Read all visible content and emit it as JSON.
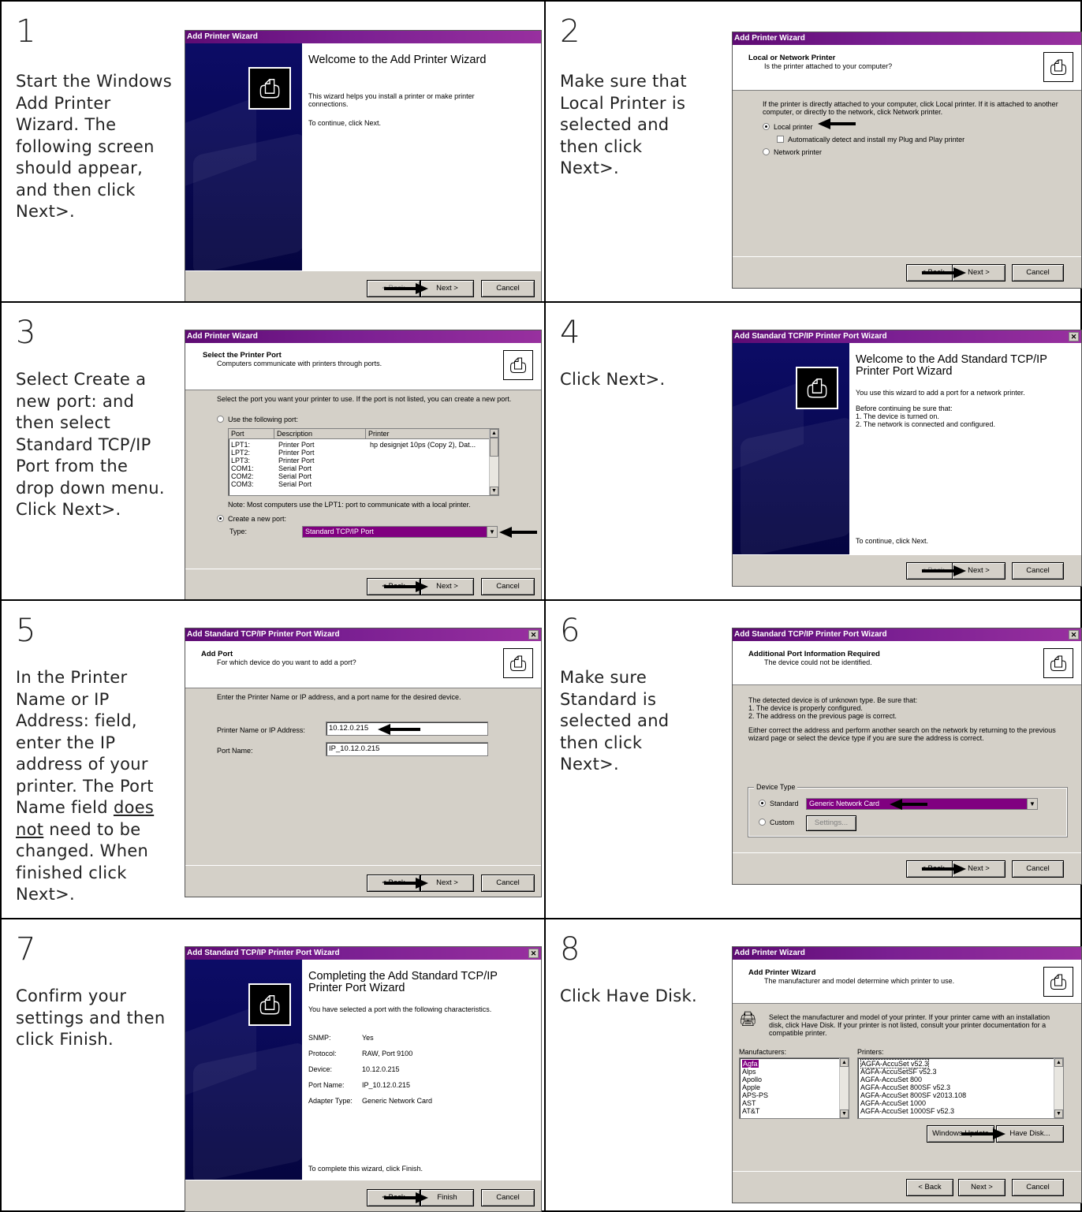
{
  "colors": {
    "title_bar": "#7a1f92",
    "dialog_bg": "#d4d0c8",
    "selection": "#800080",
    "welcome_panel": "#0c0c66"
  },
  "steps": [
    {
      "num": "1",
      "text": "Start the Windows Add Printer Wizard. The following screen should appear, and then click Next>."
    },
    {
      "num": "2",
      "text": "Make sure that Local Printer is selected and then click Next>."
    },
    {
      "num": "3",
      "text": "Select Create a new port: and then select Standard TCP/IP Port from the drop down menu. Click Next>."
    },
    {
      "num": "4",
      "text": "Click Next>."
    },
    {
      "num": "5",
      "text_a": "In the Printer Name or IP Address: field, enter the IP address of your printer. The Port Name field",
      "text_u": "does not",
      "text_b": "need to be changed. When finished click Next>."
    },
    {
      "num": "6",
      "text": "Make sure Standard is selected and then click Next>."
    },
    {
      "num": "7",
      "text": "Confirm your settings and then click Finish."
    },
    {
      "num": "8",
      "text": "Click Have Disk."
    }
  ],
  "dlg1": {
    "title": "Add Printer Wizard",
    "heading": "Welcome to the Add Printer Wizard",
    "p1": "This wizard helps you install a printer or make printer connections.",
    "p2": "To continue, click Next.",
    "back": "< Back",
    "next": "Next >",
    "cancel": "Cancel"
  },
  "dlg2": {
    "title": "Add Printer Wizard",
    "h_title": "Local or Network Printer",
    "h_sub": "Is the printer attached to your computer?",
    "body": "If the printer is directly attached to your computer, click Local printer. If it is attached to another computer, or directly to the network, click Network printer.",
    "opt_local": "Local printer",
    "opt_detect": "Automatically detect and install my Plug and Play printer",
    "opt_network": "Network printer",
    "back": "< Back",
    "next": "Next >",
    "cancel": "Cancel"
  },
  "dlg3": {
    "title": "Add Printer Wizard",
    "h_title": "Select the Printer Port",
    "h_sub": "Computers communicate with printers through ports.",
    "body": "Select the port you want your printer to use. If the port is not listed, you can create a new port.",
    "opt_use": "Use the following port:",
    "columns": [
      "Port",
      "Description",
      "Printer"
    ],
    "rows": [
      [
        "LPT1:",
        "Printer Port",
        "hp designjet 10ps (Copy 2), Dat..."
      ],
      [
        "LPT2:",
        "Printer Port",
        ""
      ],
      [
        "LPT3:",
        "Printer Port",
        ""
      ],
      [
        "COM1:",
        "Serial Port",
        ""
      ],
      [
        "COM2:",
        "Serial Port",
        ""
      ],
      [
        "COM3:",
        "Serial Port",
        ""
      ]
    ],
    "note": "Note: Most computers use the LPT1: port to communicate with a local printer.",
    "opt_create": "Create a new port:",
    "type_label": "Type:",
    "type_value": "Standard TCP/IP Port",
    "back": "< Back",
    "next": "Next >",
    "cancel": "Cancel"
  },
  "dlg4": {
    "title": "Add Standard TCP/IP Printer Port Wizard",
    "heading": "Welcome to the Add Standard TCP/IP Printer Port Wizard",
    "p1": "You use this wizard to add a port for a network printer.",
    "p2": "Before continuing be sure that:",
    "p3": "1.  The device is turned on.",
    "p4": "2.  The network is connected and configured.",
    "p5": "To continue, click Next.",
    "back": "< Back",
    "next": "Next >",
    "cancel": "Cancel"
  },
  "dlg5": {
    "title": "Add Standard TCP/IP Printer Port Wizard",
    "h_title": "Add Port",
    "h_sub": "For which device do you want to add a port?",
    "body": "Enter the Printer Name or IP address, and a port name for the desired device.",
    "ip_label": "Printer Name or IP Address:",
    "ip_value": "10.12.0.215",
    "port_label": "Port Name:",
    "port_value": "IP_10.12.0.215",
    "back": "< Back",
    "next": "Next >",
    "cancel": "Cancel"
  },
  "dlg6": {
    "title": "Add Standard TCP/IP Printer Port Wizard",
    "h_title": "Additional Port Information Required",
    "h_sub": "The device could not be identified.",
    "p1": "The detected device is of unknown type.  Be sure that:",
    "p2": "1.  The device is properly configured.",
    "p3": "2.  The address on the previous page is correct.",
    "p4": "Either correct the address and perform another search on the network by returning to the previous wizard page or select the device type if you are sure the address is correct.",
    "group": "Device Type",
    "opt_standard": "Standard",
    "standard_value": "Generic Network Card",
    "opt_custom": "Custom",
    "settings": "Settings...",
    "back": "< Back",
    "next": "Next >",
    "cancel": "Cancel"
  },
  "dlg7": {
    "title": "Add Standard TCP/IP Printer Port Wizard",
    "heading": "Completing the Add Standard TCP/IP Printer Port Wizard",
    "p1": "You have selected a port with the following characteristics.",
    "rows": [
      [
        "SNMP:",
        "Yes"
      ],
      [
        "Protocol:",
        "RAW, Port 9100"
      ],
      [
        "Device:",
        "10.12.0.215"
      ],
      [
        "Port Name:",
        "IP_10.12.0.215"
      ],
      [
        "Adapter Type:",
        "Generic Network Card"
      ]
    ],
    "p2": "To complete this wizard, click Finish.",
    "back": "< Back",
    "finish": "Finish",
    "cancel": "Cancel"
  },
  "dlg8": {
    "title": "Add Printer Wizard",
    "h_title": "Add Printer Wizard",
    "h_sub": "The manufacturer and model determine which printer to use.",
    "body": "Select the manufacturer and model of your printer. If your printer came with an installation disk, click Have Disk. If your printer is not listed, consult your printer documentation for a compatible printer.",
    "mfr_label": "Manufacturers:",
    "manufacturers": [
      "Agfa",
      "Alps",
      "Apollo",
      "Apple",
      "APS-PS",
      "AST",
      "AT&T"
    ],
    "printers_label": "Printers:",
    "printers": [
      "AGFA-AccuSet v52.3",
      "AGFA-AccuSetSF v52.3",
      "AGFA-AccuSet 800",
      "AGFA-AccuSet 800SF v52.3",
      "AGFA-AccuSet 800SF v2013.108",
      "AGFA-AccuSet 1000",
      "AGFA-AccuSet 1000SF v52.3"
    ],
    "windows_update": "Windows Update",
    "have_disk": "Have Disk...",
    "back": "< Back",
    "next": "Next >",
    "cancel": "Cancel"
  }
}
